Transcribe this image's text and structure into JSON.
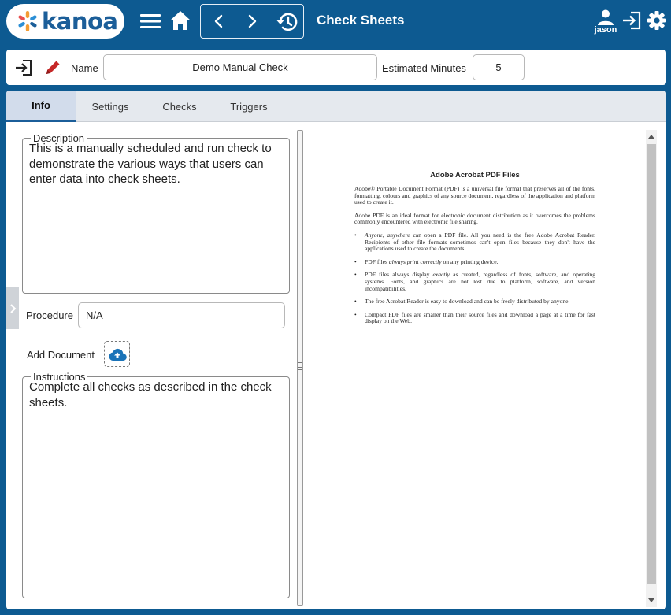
{
  "app": {
    "brand": "kanoa",
    "title": "Check Sheets",
    "user": "jason"
  },
  "header": {
    "name_label": "Name",
    "name_value": "Demo Manual Check",
    "est_label": "Estimated Minutes",
    "est_value": "5"
  },
  "tabs": [
    {
      "label": "Info",
      "active": true
    },
    {
      "label": "Settings",
      "active": false
    },
    {
      "label": "Checks",
      "active": false
    },
    {
      "label": "Triggers",
      "active": false
    }
  ],
  "info": {
    "description_label": "Description",
    "description_text": "This is a manually scheduled and run check to demonstrate the various ways that users can enter data into check sheets.",
    "procedure_label": "Procedure",
    "procedure_value": "N/A",
    "add_document_label": "Add Document",
    "instructions_label": "Instructions",
    "instructions_text": "Complete all checks as described in the check sheets."
  },
  "pdf": {
    "title": "Adobe Acrobat PDF Files",
    "p1": "Adobe® Portable Document Format (PDF) is a universal file format that preserves all of the fonts, formatting, colours and graphics of any source document, regardless of the application and platform used to create it.",
    "p2": "Adobe PDF is an ideal format for electronic document distribution as it overcomes the problems commonly encountered with electronic file sharing.",
    "b1_em": "Anyone, anywhere",
    "b1_rest": " can open a PDF file. All you need is the free Adobe Acrobat Reader. Recipients of other file formats sometimes can't open files because they don't have the applications used to create the documents.",
    "b2_pre": "PDF files ",
    "b2_em": "always print correctly",
    "b2_post": " on any printing device.",
    "b3_pre": "PDF files always display ",
    "b3_em": "exactly",
    "b3_post": " as created, regardless of fonts, software, and operating systems. Fonts, and graphics are not lost due to platform, software, and version incompatibilities.",
    "b4": "The free Acrobat Reader is easy to download and can be freely distributed by anyone.",
    "b5": "Compact PDF files are smaller than their source files and download a page at a time for fast display on the Web.",
    "bullet": "•"
  },
  "colors": {
    "appbar": "#0d5a91",
    "brand_blue": "#1b5e99",
    "edit_red": "#c62828",
    "upload_blue": "#1a73b8"
  },
  "icons": [
    "kanoa-logo-icon",
    "menu-icon",
    "home-icon",
    "chevron-left-icon",
    "chevron-right-icon",
    "history-icon",
    "user-icon",
    "logout-icon",
    "gear-icon",
    "exit-icon",
    "pencil-icon",
    "cloud-upload-icon",
    "chevron-right-icon"
  ]
}
